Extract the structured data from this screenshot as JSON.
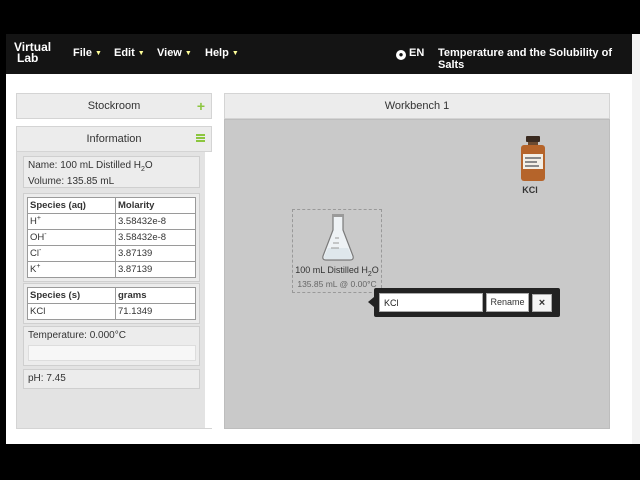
{
  "navbar": {
    "logo_line1": "Virtual",
    "logo_line2": "Lab",
    "menus": [
      "File",
      "Edit",
      "View",
      "Help"
    ],
    "language": "EN",
    "title": "Temperature and the Solubility of Salts"
  },
  "left": {
    "stockroom": "Stockroom",
    "information": "Information"
  },
  "info": {
    "name_prefix": "Name: 100 mL Distilled H",
    "name_sub": "2",
    "name_suffix": "O",
    "volume": "Volume: 135.85 mL",
    "aq_table": {
      "headers": [
        "Species (aq)",
        "Molarity"
      ],
      "rows": [
        {
          "species": "H",
          "charge": "+",
          "value": "3.58432e-8"
        },
        {
          "species": "OH",
          "charge": "-",
          "value": "3.58432e-8"
        },
        {
          "species": "Cl",
          "charge": "-",
          "value": "3.87139"
        },
        {
          "species": "K",
          "charge": "+",
          "value": "3.87139"
        }
      ]
    },
    "s_table": {
      "headers": [
        "Species (s)",
        "grams"
      ],
      "rows": [
        {
          "species": "KCl",
          "value": "71.1349"
        }
      ]
    },
    "temperature": "Temperature: 0.000°C",
    "ph": "pH: 7.45"
  },
  "workbench": {
    "title": "Workbench 1",
    "flask_label_prefix": "100 mL Distilled H",
    "flask_label_sub": "2",
    "flask_label_suffix": "O",
    "flask_sublabel": "135.85 mL @ 0.00°C",
    "bottle_label": "KCl",
    "rename_value": "KCl",
    "rename_button": "Rename",
    "close_glyph": "×"
  },
  "colors": {
    "navbar_bg": "#141414",
    "accent_green": "#8cc63f",
    "workbench_bg": "#c9c9c9"
  },
  "icons": [
    "globe-icon",
    "plus-icon",
    "hamburger-icon",
    "flask-icon",
    "bottle-icon",
    "close-icon",
    "caret-down-icon"
  ]
}
